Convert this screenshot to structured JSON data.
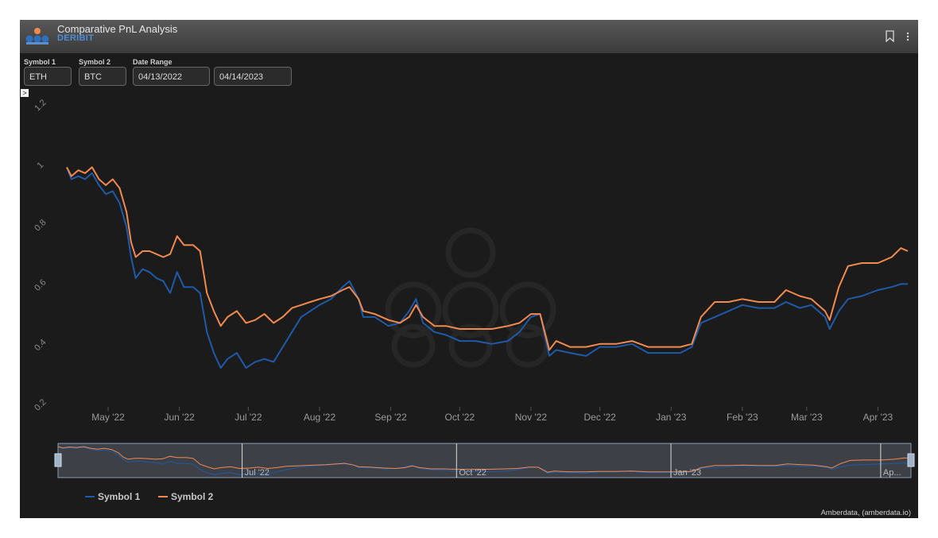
{
  "header": {
    "title": "Comparative PnL Analysis",
    "subtitle": "DERIBIT",
    "icons": [
      "bookmark-icon",
      "more-vertical-icon"
    ]
  },
  "filters": {
    "symbol1_label": "Symbol 1",
    "symbol1_value": "ETH",
    "symbol2_label": "Symbol 2",
    "symbol2_value": "BTC",
    "date_range_label": "Date Range",
    "date_start": "04/13/2022",
    "date_end": "04/14/2023"
  },
  "collapse_label": ">",
  "credit": "Amberdata, (amberdata.io)",
  "navigator_labels": [
    "Jul '22",
    "Oct '22",
    "Jan '23",
    "Ap..."
  ],
  "colors": {
    "symbol1": "#1f5aa8",
    "symbol2": "#f28a50"
  },
  "chart_data": {
    "type": "line",
    "x_type": "date",
    "x_start": "2022-04-13",
    "x_end": "2023-04-14",
    "ylim": [
      0.2,
      1.2
    ],
    "yticks": [
      "0.2",
      "0.4",
      "0.6",
      "0.8",
      "1",
      "1.2"
    ],
    "xticks": [
      "May '22",
      "Jun '22",
      "Jul '22",
      "Aug '22",
      "Sep '22",
      "Oct '22",
      "Nov '22",
      "Dec '22",
      "Jan '23",
      "Feb '23",
      "Mar '23",
      "Apr '23"
    ],
    "legend_position": "bottom-left",
    "series": [
      {
        "name": "Symbol 1",
        "points": [
          [
            "2022-04-13",
            1.0
          ],
          [
            "2022-04-15",
            0.96
          ],
          [
            "2022-04-18",
            0.97
          ],
          [
            "2022-04-21",
            0.96
          ],
          [
            "2022-04-24",
            0.98
          ],
          [
            "2022-04-27",
            0.94
          ],
          [
            "2022-04-30",
            0.91
          ],
          [
            "2022-05-03",
            0.92
          ],
          [
            "2022-05-06",
            0.88
          ],
          [
            "2022-05-09",
            0.8
          ],
          [
            "2022-05-11",
            0.7
          ],
          [
            "2022-05-13",
            0.63
          ],
          [
            "2022-05-16",
            0.66
          ],
          [
            "2022-05-19",
            0.65
          ],
          [
            "2022-05-22",
            0.63
          ],
          [
            "2022-05-25",
            0.62
          ],
          [
            "2022-05-28",
            0.58
          ],
          [
            "2022-05-31",
            0.65
          ],
          [
            "2022-06-03",
            0.6
          ],
          [
            "2022-06-07",
            0.6
          ],
          [
            "2022-06-10",
            0.58
          ],
          [
            "2022-06-13",
            0.45
          ],
          [
            "2022-06-16",
            0.38
          ],
          [
            "2022-06-19",
            0.33
          ],
          [
            "2022-06-22",
            0.36
          ],
          [
            "2022-06-26",
            0.38
          ],
          [
            "2022-06-30",
            0.33
          ],
          [
            "2022-07-04",
            0.35
          ],
          [
            "2022-07-08",
            0.36
          ],
          [
            "2022-07-12",
            0.35
          ],
          [
            "2022-07-16",
            0.4
          ],
          [
            "2022-07-20",
            0.45
          ],
          [
            "2022-07-24",
            0.5
          ],
          [
            "2022-07-28",
            0.52
          ],
          [
            "2022-08-01",
            0.54
          ],
          [
            "2022-08-06",
            0.56
          ],
          [
            "2022-08-11",
            0.6
          ],
          [
            "2022-08-14",
            0.62
          ],
          [
            "2022-08-18",
            0.56
          ],
          [
            "2022-08-20",
            0.5
          ],
          [
            "2022-08-25",
            0.5
          ],
          [
            "2022-08-31",
            0.47
          ],
          [
            "2022-09-05",
            0.48
          ],
          [
            "2022-09-09",
            0.52
          ],
          [
            "2022-09-12",
            0.56
          ],
          [
            "2022-09-15",
            0.48
          ],
          [
            "2022-09-20",
            0.45
          ],
          [
            "2022-09-25",
            0.44
          ],
          [
            "2022-10-01",
            0.42
          ],
          [
            "2022-10-08",
            0.42
          ],
          [
            "2022-10-15",
            0.41
          ],
          [
            "2022-10-22",
            0.42
          ],
          [
            "2022-10-27",
            0.45
          ],
          [
            "2022-11-01",
            0.5
          ],
          [
            "2022-11-05",
            0.51
          ],
          [
            "2022-11-09",
            0.37
          ],
          [
            "2022-11-12",
            0.39
          ],
          [
            "2022-11-18",
            0.38
          ],
          [
            "2022-11-25",
            0.37
          ],
          [
            "2022-12-01",
            0.4
          ],
          [
            "2022-12-08",
            0.4
          ],
          [
            "2022-12-15",
            0.41
          ],
          [
            "2022-12-22",
            0.38
          ],
          [
            "2022-12-29",
            0.38
          ],
          [
            "2023-01-05",
            0.38
          ],
          [
            "2023-01-10",
            0.4
          ],
          [
            "2023-01-14",
            0.48
          ],
          [
            "2023-01-20",
            0.5
          ],
          [
            "2023-01-26",
            0.52
          ],
          [
            "2023-02-01",
            0.54
          ],
          [
            "2023-02-08",
            0.53
          ],
          [
            "2023-02-15",
            0.53
          ],
          [
            "2023-02-20",
            0.55
          ],
          [
            "2023-02-26",
            0.53
          ],
          [
            "2023-03-03",
            0.54
          ],
          [
            "2023-03-09",
            0.5
          ],
          [
            "2023-03-11",
            0.46
          ],
          [
            "2023-03-15",
            0.52
          ],
          [
            "2023-03-19",
            0.56
          ],
          [
            "2023-03-25",
            0.57
          ],
          [
            "2023-04-01",
            0.59
          ],
          [
            "2023-04-07",
            0.6
          ],
          [
            "2023-04-11",
            0.61
          ],
          [
            "2023-04-14",
            0.61
          ]
        ]
      },
      {
        "name": "Symbol 2",
        "points": [
          [
            "2022-04-13",
            1.0
          ],
          [
            "2022-04-15",
            0.97
          ],
          [
            "2022-04-18",
            0.99
          ],
          [
            "2022-04-21",
            0.98
          ],
          [
            "2022-04-24",
            1.0
          ],
          [
            "2022-04-27",
            0.96
          ],
          [
            "2022-04-30",
            0.94
          ],
          [
            "2022-05-03",
            0.96
          ],
          [
            "2022-05-06",
            0.93
          ],
          [
            "2022-05-09",
            0.85
          ],
          [
            "2022-05-11",
            0.75
          ],
          [
            "2022-05-13",
            0.7
          ],
          [
            "2022-05-16",
            0.72
          ],
          [
            "2022-05-19",
            0.72
          ],
          [
            "2022-05-22",
            0.71
          ],
          [
            "2022-05-25",
            0.7
          ],
          [
            "2022-05-28",
            0.71
          ],
          [
            "2022-05-31",
            0.77
          ],
          [
            "2022-06-03",
            0.74
          ],
          [
            "2022-06-07",
            0.74
          ],
          [
            "2022-06-10",
            0.72
          ],
          [
            "2022-06-13",
            0.58
          ],
          [
            "2022-06-16",
            0.52
          ],
          [
            "2022-06-19",
            0.47
          ],
          [
            "2022-06-22",
            0.5
          ],
          [
            "2022-06-26",
            0.52
          ],
          [
            "2022-06-30",
            0.48
          ],
          [
            "2022-07-04",
            0.49
          ],
          [
            "2022-07-08",
            0.51
          ],
          [
            "2022-07-12",
            0.48
          ],
          [
            "2022-07-16",
            0.5
          ],
          [
            "2022-07-20",
            0.53
          ],
          [
            "2022-07-24",
            0.54
          ],
          [
            "2022-07-28",
            0.55
          ],
          [
            "2022-08-01",
            0.56
          ],
          [
            "2022-08-06",
            0.57
          ],
          [
            "2022-08-11",
            0.59
          ],
          [
            "2022-08-14",
            0.6
          ],
          [
            "2022-08-18",
            0.56
          ],
          [
            "2022-08-20",
            0.52
          ],
          [
            "2022-08-25",
            0.51
          ],
          [
            "2022-08-31",
            0.49
          ],
          [
            "2022-09-05",
            0.48
          ],
          [
            "2022-09-09",
            0.5
          ],
          [
            "2022-09-12",
            0.54
          ],
          [
            "2022-09-15",
            0.5
          ],
          [
            "2022-09-20",
            0.47
          ],
          [
            "2022-09-25",
            0.47
          ],
          [
            "2022-10-01",
            0.46
          ],
          [
            "2022-10-08",
            0.46
          ],
          [
            "2022-10-15",
            0.46
          ],
          [
            "2022-10-22",
            0.47
          ],
          [
            "2022-10-27",
            0.48
          ],
          [
            "2022-11-01",
            0.51
          ],
          [
            "2022-11-05",
            0.51
          ],
          [
            "2022-11-09",
            0.39
          ],
          [
            "2022-11-12",
            0.42
          ],
          [
            "2022-11-18",
            0.4
          ],
          [
            "2022-11-25",
            0.4
          ],
          [
            "2022-12-01",
            0.41
          ],
          [
            "2022-12-08",
            0.41
          ],
          [
            "2022-12-15",
            0.42
          ],
          [
            "2022-12-22",
            0.4
          ],
          [
            "2022-12-29",
            0.4
          ],
          [
            "2023-01-05",
            0.4
          ],
          [
            "2023-01-10",
            0.41
          ],
          [
            "2023-01-14",
            0.5
          ],
          [
            "2023-01-20",
            0.55
          ],
          [
            "2023-01-26",
            0.55
          ],
          [
            "2023-02-01",
            0.56
          ],
          [
            "2023-02-08",
            0.55
          ],
          [
            "2023-02-15",
            0.55
          ],
          [
            "2023-02-20",
            0.59
          ],
          [
            "2023-02-26",
            0.57
          ],
          [
            "2023-03-03",
            0.56
          ],
          [
            "2023-03-09",
            0.52
          ],
          [
            "2023-03-11",
            0.49
          ],
          [
            "2023-03-15",
            0.6
          ],
          [
            "2023-03-19",
            0.67
          ],
          [
            "2023-03-25",
            0.68
          ],
          [
            "2023-04-01",
            0.68
          ],
          [
            "2023-04-07",
            0.7
          ],
          [
            "2023-04-11",
            0.73
          ],
          [
            "2023-04-14",
            0.72
          ]
        ]
      }
    ]
  }
}
